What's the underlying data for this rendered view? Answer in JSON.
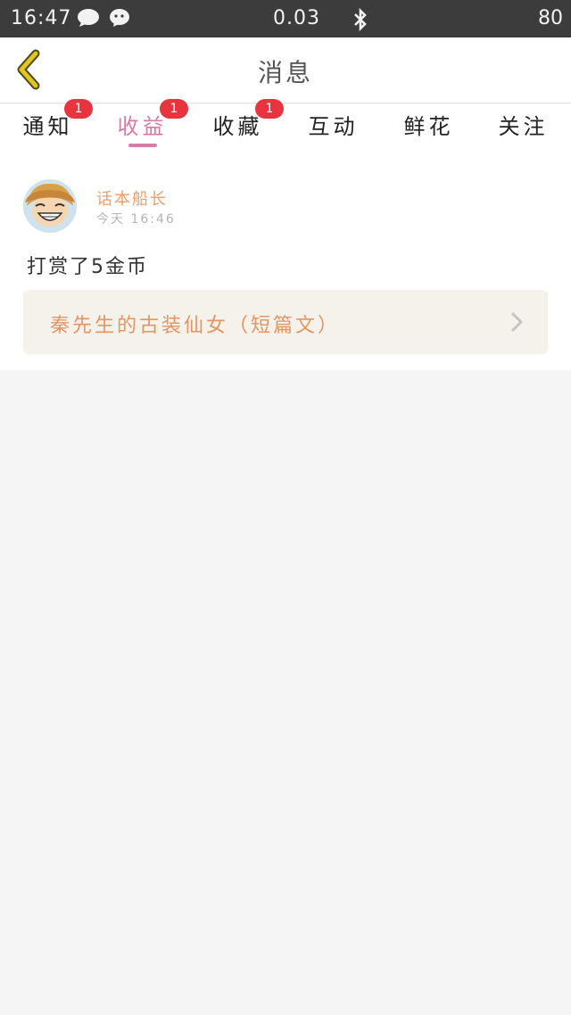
{
  "status_bar": {
    "time": "16:47",
    "network_speed": "0.03",
    "battery": "80",
    "icons": [
      "chat-bubble-icon",
      "wechat-icon",
      "bluetooth-icon"
    ]
  },
  "header": {
    "title": "消息",
    "back_icon": "chevron-left-icon"
  },
  "tabs": [
    {
      "label": "通知",
      "badge": "1"
    },
    {
      "label": "收益",
      "badge": "1",
      "active": true
    },
    {
      "label": "收藏",
      "badge": "1"
    },
    {
      "label": "互动"
    },
    {
      "label": "鲜花"
    },
    {
      "label": "关注"
    }
  ],
  "message": {
    "sender": "话本船长",
    "time": "今天 16:46",
    "text": "打赏了5金币",
    "article_title": "秦先生的古装仙女（短篇文）"
  },
  "colors": {
    "accent": "#d67aa8",
    "badge": "#e8343f",
    "sender": "#e6a070",
    "article": "#e49564",
    "back_icon": "#e2c520"
  }
}
